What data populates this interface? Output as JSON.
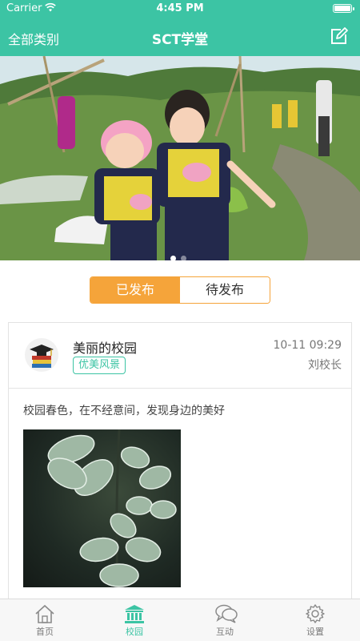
{
  "status_bar": {
    "carrier": "Carrier",
    "time": "4:45 PM"
  },
  "nav": {
    "left_label": "全部类别",
    "title": "SCT学堂",
    "right_icon": "edit-icon"
  },
  "banner": {
    "slides": 2,
    "current": 1
  },
  "segment": {
    "tabs": [
      "已发布",
      "待发布"
    ],
    "selected": 0
  },
  "post": {
    "title": "美丽的校园",
    "tag": "优美风景",
    "time": "10-11 09:29",
    "author": "刘校长",
    "text": "校园春色，在不经意间，发现身边的美好"
  },
  "tabbar": {
    "items": [
      {
        "label": "首页",
        "icon": "home-icon"
      },
      {
        "label": "校园",
        "icon": "campus-icon"
      },
      {
        "label": "互动",
        "icon": "chat-icon"
      },
      {
        "label": "设置",
        "icon": "settings-icon"
      }
    ],
    "selected": 1
  },
  "colors": {
    "brand": "#3cc4a4",
    "accent": "#f5a43a"
  }
}
